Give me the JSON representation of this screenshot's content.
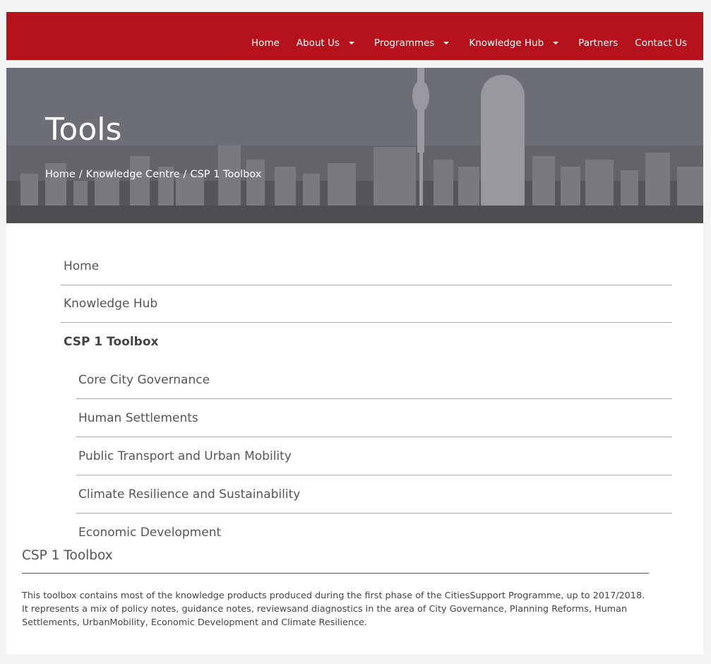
{
  "nav": {
    "items": [
      {
        "label": "Home"
      },
      {
        "label": "About Us"
      },
      {
        "label": "Programmes"
      },
      {
        "label": "Knowledge Hub"
      },
      {
        "label": "Partners"
      },
      {
        "label": "Contact Us"
      }
    ]
  },
  "hero": {
    "title": "Tools",
    "breadcrumb": [
      "Home",
      "Knowledge Centre",
      "CSP 1 Toolbox"
    ],
    "separator": "/"
  },
  "sidebar": {
    "items": [
      "Home",
      "Knowledge Hub"
    ],
    "section": "CSP 1 Toolbox",
    "subitems": [
      "Core City Governance",
      "Human Settlements",
      "Public Transport and Urban Mobility",
      "Climate Resilience and Sustainability",
      "Economic Development"
    ]
  },
  "content": {
    "title": "CSP 1 Toolbox",
    "body": "This toolbox contains most of the knowledge products produced during the first phase of the CitiesSupport Programme, up to 2017/2018. It represents a mix of policy notes, guidance notes, reviewsand diagnostics in the area of City Governance, Planning Reforms, Human Settlements, UrbanMobility, Economic Development and Climate Resilience."
  },
  "colors": {
    "brand_red": "#b5121b",
    "page_bg": "#f3f4f4"
  }
}
